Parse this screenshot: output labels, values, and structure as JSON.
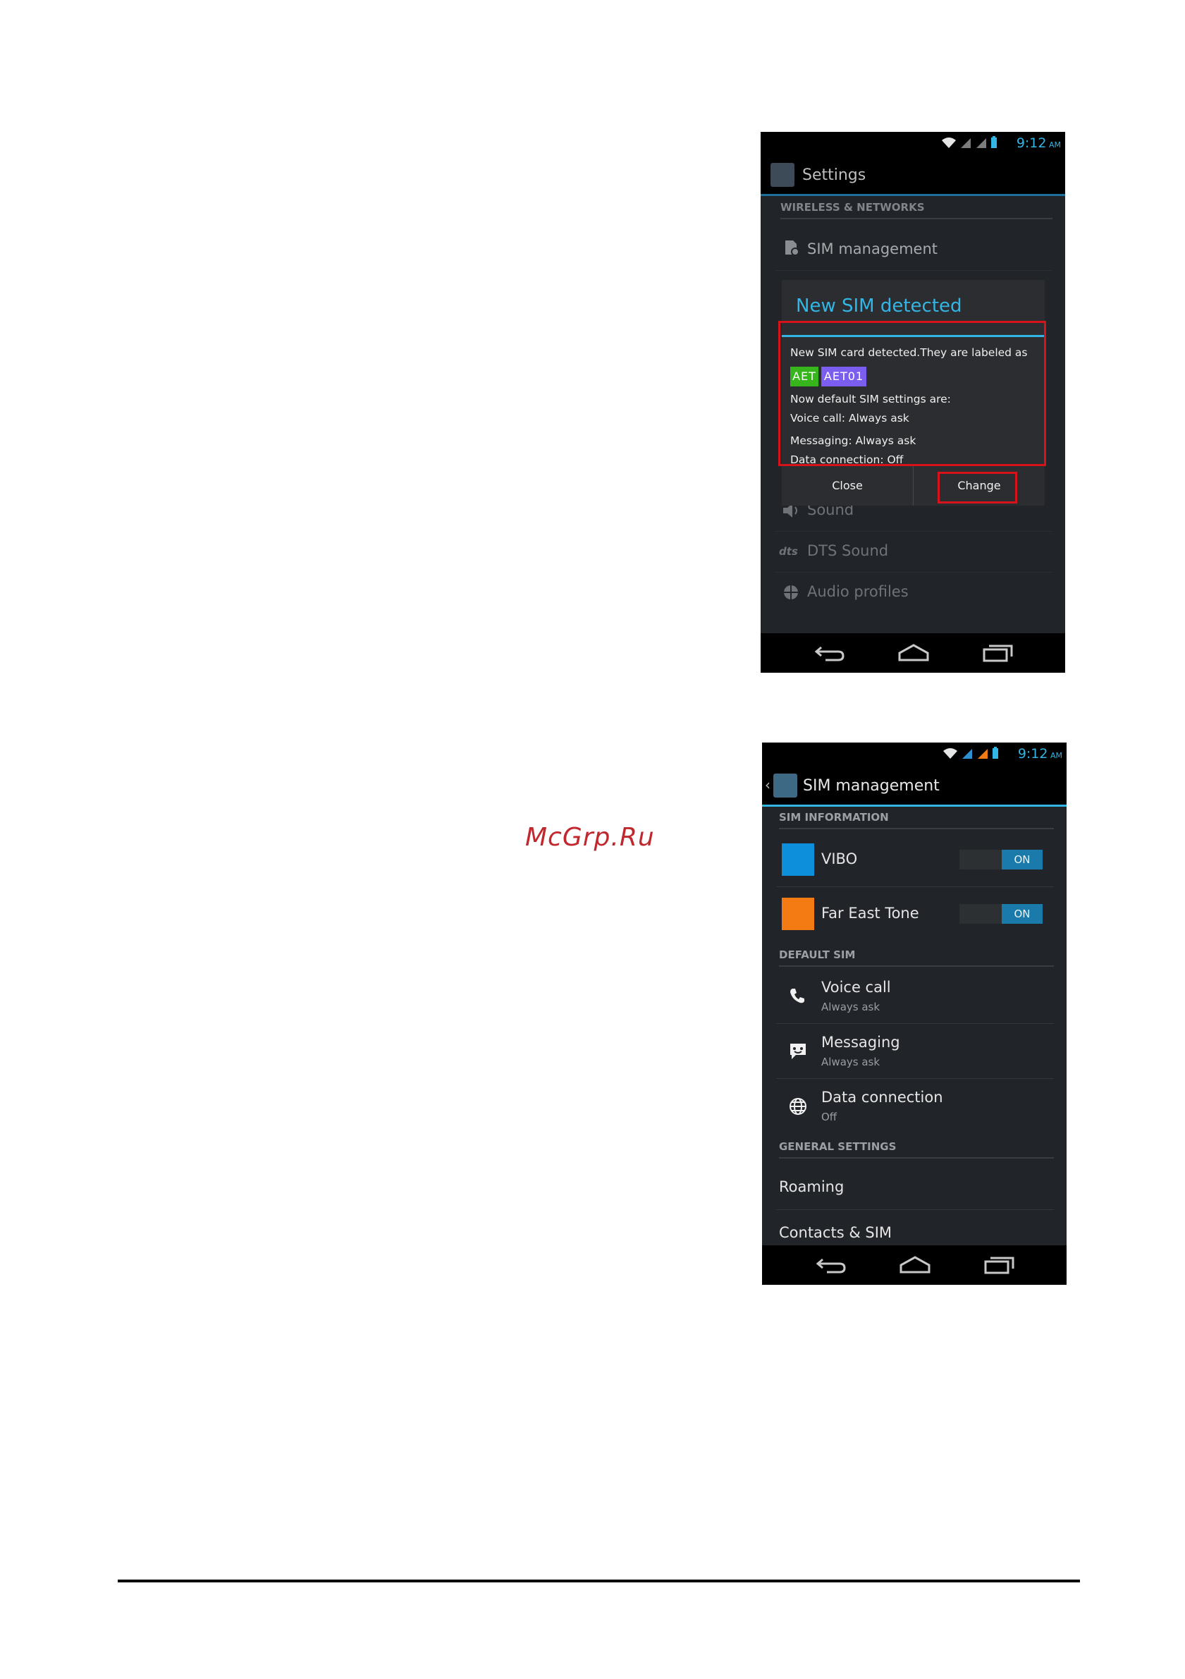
{
  "watermark": "McGrp.Ru",
  "screen1": {
    "time": "9:12",
    "ampm": "AM",
    "title": "Settings",
    "section": "WIRELESS & NETWORKS",
    "items": {
      "sim_management": "SIM management",
      "sound": "Sound",
      "dts_sound": "DTS Sound",
      "audio_profiles": "Audio profiles"
    },
    "dialog": {
      "title": "New SIM detected",
      "line1": "New SIM card detected.They are labeled as",
      "chip1": "AET",
      "chip2": "AET01",
      "line2": "Now default SIM settings are:",
      "line3": "Voice call: Always ask",
      "line4": "Messaging: Always ask",
      "line5": "Data connection: Off",
      "close": "Close",
      "change": "Change"
    },
    "colors": {
      "chip1": "#37b61b",
      "chip2": "#7b5ef0",
      "highlight": "#d6121b"
    }
  },
  "screen2": {
    "time": "9:12",
    "ampm": "AM",
    "title": "SIM management",
    "sections": {
      "sim_info": "SIM INFORMATION",
      "default_sim": "DEFAULT SIM",
      "general": "GENERAL SETTINGS"
    },
    "sims": [
      {
        "name": "VIBO",
        "toggle": "ON",
        "color": "#0d8fdb"
      },
      {
        "name": "Far East Tone",
        "toggle": "ON",
        "color": "#f47a14"
      }
    ],
    "defaults": [
      {
        "label": "Voice call",
        "value": "Always ask",
        "icon": "phone-icon"
      },
      {
        "label": "Messaging",
        "value": "Always ask",
        "icon": "message-icon"
      },
      {
        "label": "Data connection",
        "value": "Off",
        "icon": "globe-icon"
      }
    ],
    "general": {
      "roaming": "Roaming",
      "contacts": "Contacts & SIM"
    }
  }
}
